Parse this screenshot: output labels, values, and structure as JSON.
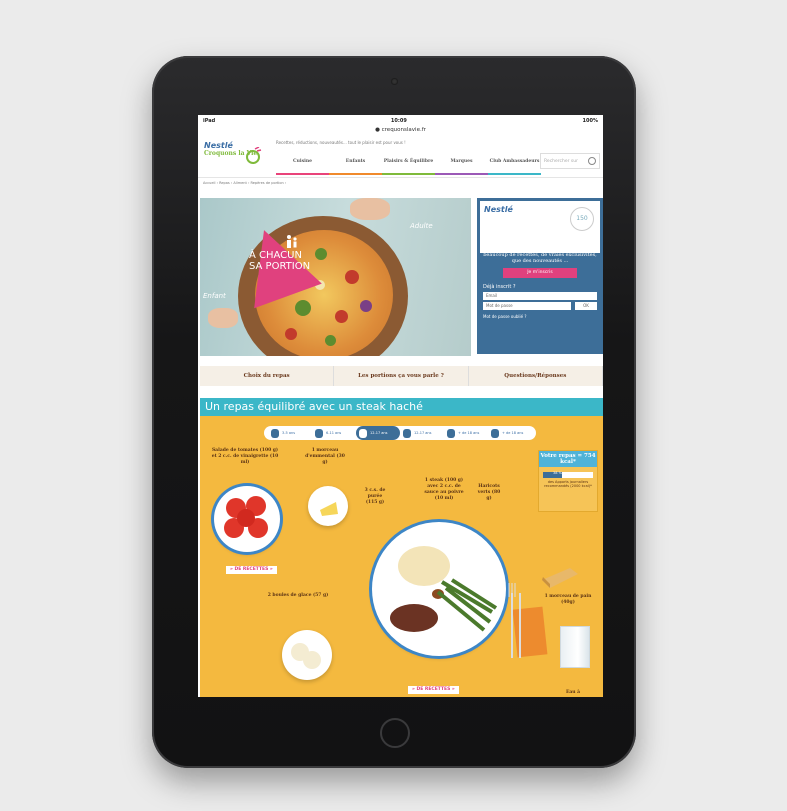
{
  "device": {
    "status_left": "iPad",
    "time": "10:09",
    "battery": "100%",
    "url": "crequonslavie.fr"
  },
  "site": {
    "logo_brand": "Nestlé",
    "logo_sub": "Croquons la Vie",
    "tagline": "Recettes, réductions, nouveautés... tout le plaisir est pour vous !",
    "nav": [
      {
        "label": "Cuisine",
        "color": "#e9437a"
      },
      {
        "label": "Enfants",
        "color": "#f08a2c"
      },
      {
        "label": "Plaisirs & Équilibre",
        "color": "#7fba3b"
      },
      {
        "label": "Marques",
        "color": "#9b59b6"
      },
      {
        "label": "Club Ambassadeurs",
        "color": "#3bb7c8"
      }
    ],
    "search_placeholder": "Rechercher sur",
    "breadcrumb": "Accueil › Repas › Aliment › Repères de portion ›"
  },
  "hero": {
    "headline_1": "À CHACUN",
    "headline_2": "SA PORTION",
    "label_adult": "Adulte",
    "label_child": "Enfant"
  },
  "promo": {
    "badge": "150",
    "title": "Plein de réductions,",
    "text": "beaucoup de recettes, de vraies exclusivités, que des nouveautés ...",
    "button": "Je m'inscris",
    "already": "Déjà inscrit ?",
    "email_placeholder": "Email",
    "password_placeholder": "Mot de passe",
    "ok": "OK",
    "forgot": "Mot de passe oublié ?"
  },
  "tabs": [
    "Choix du repas",
    "Les portions ça vous parle ?",
    "Questions/Réponses"
  ],
  "section": {
    "title": "Un repas équilibré avec un steak haché",
    "ages": [
      "3-5 ans",
      "6-11 ans",
      "12-17 ans",
      "12-17 ans",
      "+ de 18 ans",
      "+ de 18 ans"
    ],
    "foods": {
      "salad": "Salade de tomates (100 g) et 2 c.c. de vinaigrette (10 ml)",
      "cheese": "1 morceau d'emmental (30 g)",
      "puree": "3 c.s. de purée (115 g)",
      "steak": "1 steak (100 g) avec 2 c.c. de sauce au poivre (10 ml)",
      "beans": "Haricots verts (80 g)",
      "icecream": "2 boules de glace (57 g)",
      "bread": "1 morceau de pain (40g)",
      "water": "Eau à"
    },
    "recipes_button": "» DE RECETTES »",
    "recipes_button_2": "» DE RECETTES »",
    "repas_title": "Votre repas = 754 kcal*",
    "repas_pct": "38 %",
    "repas_fill": 0.38,
    "repas_note": "des Apports journaliers recommandés (2000 kcal)*"
  }
}
